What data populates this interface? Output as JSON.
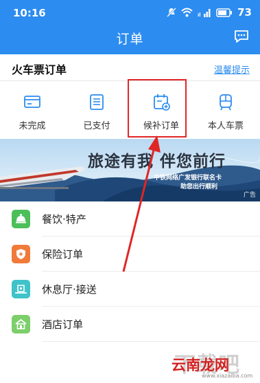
{
  "status_bar": {
    "time": "10:16",
    "battery": "73",
    "icons": [
      "mute-icon",
      "wifi-icon",
      "signal-icon",
      "battery-icon"
    ]
  },
  "header": {
    "title": "订单",
    "chat_icon": "chat-icon",
    "bg_color": "#2c8cf0"
  },
  "section": {
    "title": "火车票订单",
    "tip_link": "温馨提示"
  },
  "order_tabs": [
    {
      "label": "未完成",
      "icon": "card-icon"
    },
    {
      "label": "已支付",
      "icon": "document-icon"
    },
    {
      "label": "候补订单",
      "icon": "calendar-add-icon",
      "highlighted": true
    },
    {
      "label": "本人车票",
      "icon": "train-icon"
    }
  ],
  "banner": {
    "headline": "旅途有我 伴您前行",
    "subline1": "中铁网络广发银行联名卡",
    "subline2": "助您出行顺利",
    "ad_label": "广告"
  },
  "services": [
    {
      "label": "餐饮·特产",
      "icon": "food-bell-icon",
      "color": "#4cbf5a"
    },
    {
      "label": "保险订单",
      "icon": "shield-icon",
      "color": "#f07a3a"
    },
    {
      "label": "休息厅·接送",
      "icon": "lounge-icon",
      "color": "#3fc3c9"
    },
    {
      "label": "酒店订单",
      "icon": "hotel-icon",
      "color": "#7ccf6a"
    }
  ],
  "watermark": {
    "big": "下载吧",
    "main": "云南龙网",
    "url": "www.xiazaiba.com"
  },
  "annotation_color": "#e02525"
}
